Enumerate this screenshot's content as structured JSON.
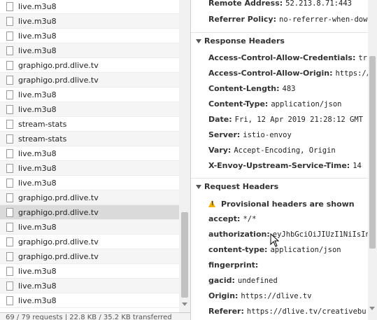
{
  "requests": [
    {
      "name": "live.m3u8"
    },
    {
      "name": "live.m3u8"
    },
    {
      "name": "live.m3u8"
    },
    {
      "name": "live.m3u8"
    },
    {
      "name": "graphigo.prd.dlive.tv"
    },
    {
      "name": "graphigo.prd.dlive.tv"
    },
    {
      "name": "live.m3u8"
    },
    {
      "name": "live.m3u8"
    },
    {
      "name": "stream-stats"
    },
    {
      "name": "stream-stats"
    },
    {
      "name": "live.m3u8"
    },
    {
      "name": "live.m3u8"
    },
    {
      "name": "live.m3u8"
    },
    {
      "name": "graphigo.prd.dlive.tv"
    },
    {
      "name": "graphigo.prd.dlive.tv",
      "selected": true
    },
    {
      "name": "live.m3u8"
    },
    {
      "name": "graphigo.prd.dlive.tv"
    },
    {
      "name": "graphigo.prd.dlive.tv"
    },
    {
      "name": "live.m3u8"
    },
    {
      "name": "live.m3u8"
    },
    {
      "name": "live.m3u8"
    }
  ],
  "status_bar": "69 / 79 requests | 22.8 KB / 35.2 KB transferred",
  "general": [
    {
      "name": "Remote Address:",
      "value": "52.213.8.71:443"
    },
    {
      "name": "Referrer Policy:",
      "value": "no-referrer-when-down"
    }
  ],
  "response_headers": {
    "title": "Response Headers",
    "items": [
      {
        "name": "Access-Control-Allow-Credentials:",
        "value": "true"
      },
      {
        "name": "Access-Control-Allow-Origin:",
        "value": "https://d"
      },
      {
        "name": "Content-Length:",
        "value": "483"
      },
      {
        "name": "Content-Type:",
        "value": "application/json"
      },
      {
        "name": "Date:",
        "value": "Fri, 12 Apr 2019 21:28:12 GMT"
      },
      {
        "name": "Server:",
        "value": "istio-envoy"
      },
      {
        "name": "Vary:",
        "value": "Accept-Encoding, Origin"
      },
      {
        "name": "X-Envoy-Upstream-Service-Time:",
        "value": "14"
      }
    ]
  },
  "request_headers": {
    "title": "Request Headers",
    "warning": "Provisional headers are shown",
    "items": [
      {
        "name": "accept:",
        "value": "*/*"
      },
      {
        "name": "authorization:",
        "value": "eyJhbGciOiJIUzI1NiIsIn"
      },
      {
        "name": "content-type:",
        "value": "application/json"
      },
      {
        "name": "fingerprint:",
        "value": ""
      },
      {
        "name": "gacid:",
        "value": "undefined"
      },
      {
        "name": "Origin:",
        "value": "https://dlive.tv"
      },
      {
        "name": "Referer:",
        "value": "https://dlive.tv/creativebu"
      }
    ]
  }
}
